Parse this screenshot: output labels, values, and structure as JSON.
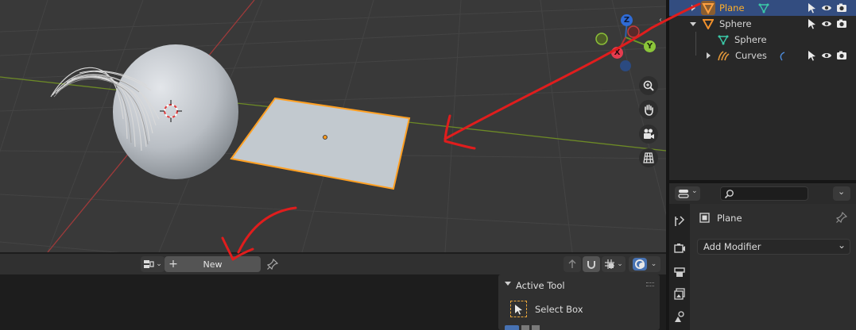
{
  "outliner": {
    "rows": [
      {
        "label": "Plane"
      },
      {
        "label": "Sphere"
      },
      {
        "label": "Sphere"
      },
      {
        "label": "Curves"
      }
    ]
  },
  "gizmo": {
    "z": "Z",
    "y": "Y",
    "x": "X"
  },
  "properties": {
    "object_name": "Plane",
    "add_modifier": "Add Modifier"
  },
  "bottom": {
    "new_label": "New",
    "plus": "+"
  },
  "tool_panel": {
    "title": "Active Tool",
    "tool": "Select Box"
  },
  "colors": {
    "viewport_bg": "#393939",
    "selection_orange": "#ffa023",
    "annotation_red": "#e01d1d",
    "outliner_selected": "#334d80",
    "axis_red": "#9e3a3a",
    "axis_green": "#6d8a26"
  }
}
